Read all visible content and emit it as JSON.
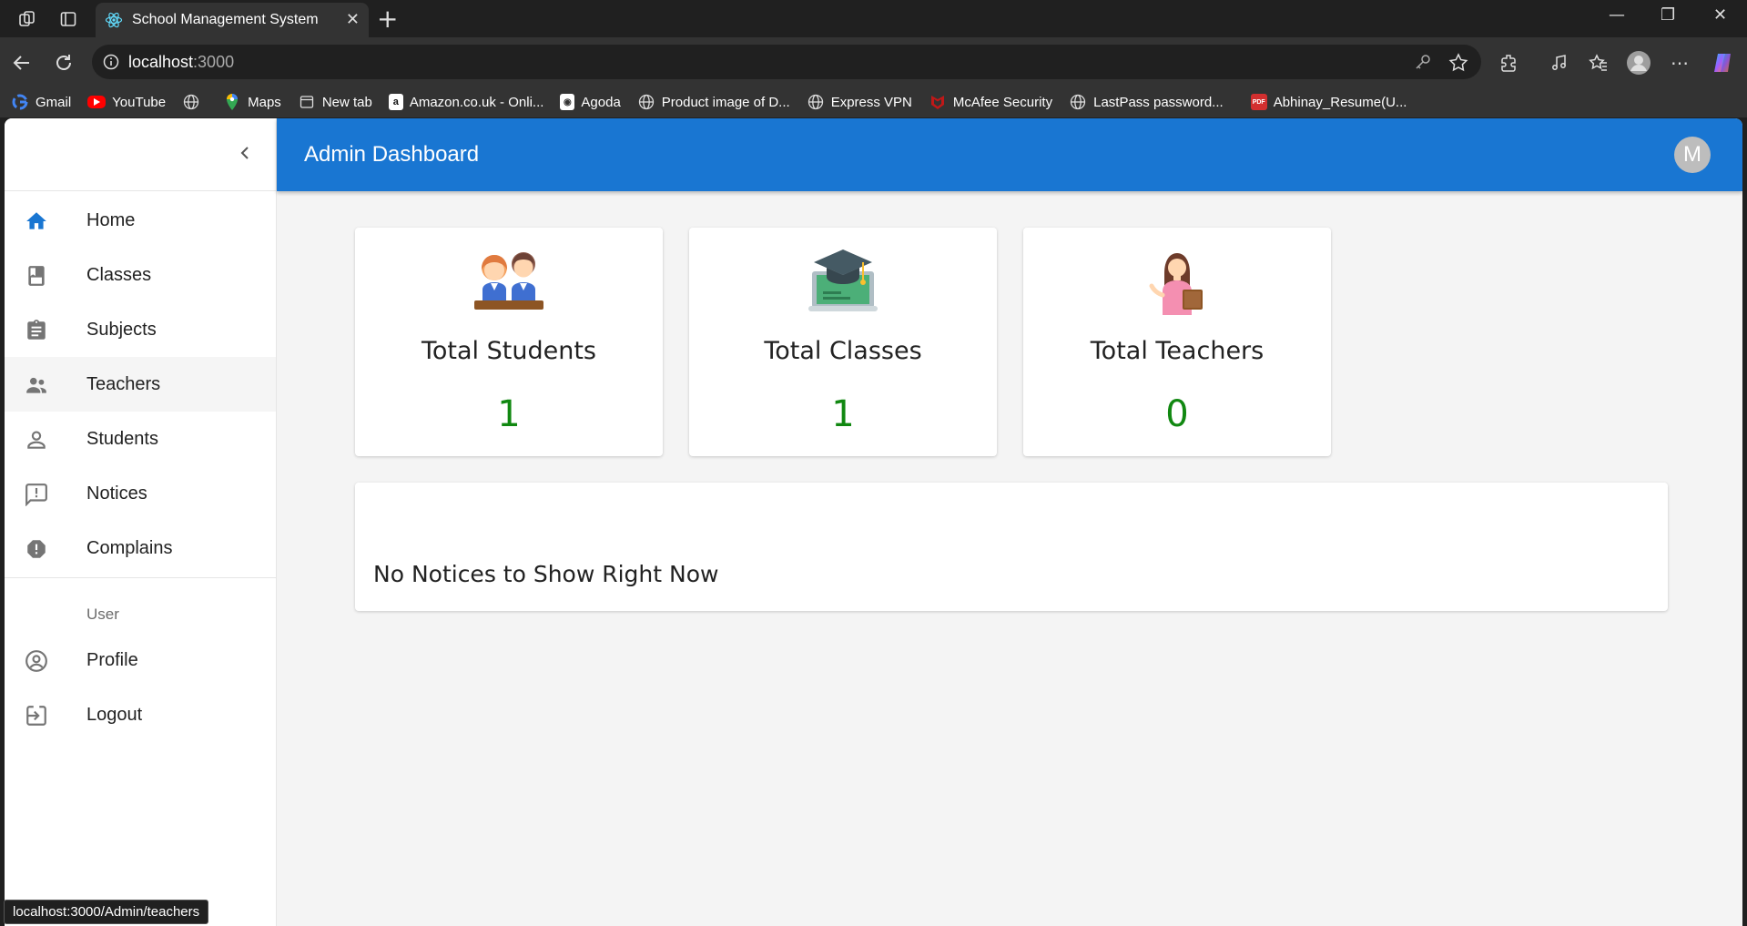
{
  "browser": {
    "tab_title": "School Management System",
    "url_host": "localhost",
    "url_port": ":3000",
    "bookmarks": [
      {
        "label": "Gmail",
        "icon": "google-icon"
      },
      {
        "label": "YouTube",
        "icon": "youtube-icon"
      },
      {
        "label": "",
        "icon": "globe-icon"
      },
      {
        "label": "Maps",
        "icon": "maps-icon"
      },
      {
        "label": "New tab",
        "icon": "newtab-icon"
      },
      {
        "label": "Amazon.co.uk - Onli...",
        "icon": "amazon-icon"
      },
      {
        "label": "Agoda",
        "icon": "agoda-icon"
      },
      {
        "label": "Product image of D...",
        "icon": "globe-icon"
      },
      {
        "label": "Express VPN",
        "icon": "globe-icon"
      },
      {
        "label": "McAfee Security",
        "icon": "mcafee-icon"
      },
      {
        "label": "LastPass password...",
        "icon": "globe-icon"
      },
      {
        "label": "Abhinay_Resume(U...",
        "icon": "pdf-icon"
      }
    ],
    "status_url": "localhost:3000/Admin/teachers"
  },
  "appbar": {
    "title": "Admin Dashboard",
    "avatar_letter": "M"
  },
  "sidebar": {
    "items": [
      {
        "label": "Home",
        "icon": "home-icon"
      },
      {
        "label": "Classes",
        "icon": "class-icon"
      },
      {
        "label": "Subjects",
        "icon": "assignment-icon"
      },
      {
        "label": "Teachers",
        "icon": "supervisor-icon"
      },
      {
        "label": "Students",
        "icon": "person-icon"
      },
      {
        "label": "Notices",
        "icon": "announcement-icon"
      },
      {
        "label": "Complains",
        "icon": "report-icon"
      }
    ],
    "subheader": "User",
    "user_items": [
      {
        "label": "Profile",
        "icon": "account-circle-icon"
      },
      {
        "label": "Logout",
        "icon": "logout-icon"
      }
    ]
  },
  "stats": [
    {
      "title": "Total Students",
      "value": "1",
      "icon": "students-illustration"
    },
    {
      "title": "Total Classes",
      "value": "1",
      "icon": "classes-illustration"
    },
    {
      "title": "Total Teachers",
      "value": "0",
      "icon": "teachers-illustration"
    }
  ],
  "notices": {
    "empty_text": "No Notices to Show Right Now"
  },
  "colors": {
    "primary": "#1976d2",
    "value_green": "#118811",
    "home_icon": "#1976d2"
  }
}
